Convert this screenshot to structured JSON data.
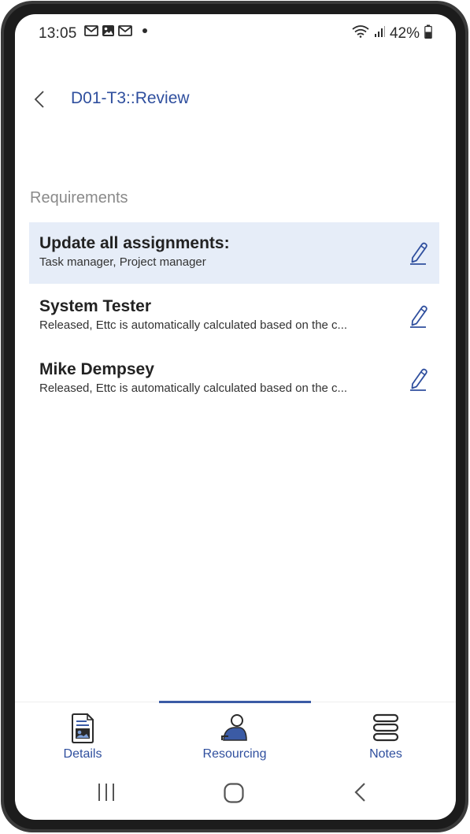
{
  "status_bar": {
    "time": "13:05",
    "battery": "42%",
    "notification_icons": [
      "gmail-icon",
      "image-icon",
      "gmail-icon",
      "dot-icon"
    ]
  },
  "header": {
    "title": "D01-T3::Review"
  },
  "section_title": "Requirements",
  "items": [
    {
      "title": "Update all assignments:",
      "subtitle": "Task manager, Project manager",
      "selected": true
    },
    {
      "title": "System Tester",
      "subtitle": "Released, Ettc is automatically calculated based on the c...",
      "selected": false
    },
    {
      "title": "Mike Dempsey",
      "subtitle": "Released, Ettc is automatically calculated based on the c...",
      "selected": false
    }
  ],
  "bottom_nav": {
    "tabs": [
      {
        "label": "Details",
        "icon": "details-icon"
      },
      {
        "label": "Resourcing",
        "icon": "resourcing-icon",
        "active": true
      },
      {
        "label": "Notes",
        "icon": "notes-icon"
      }
    ]
  },
  "colors": {
    "accent": "#2f4f9e",
    "selected_row": "#e6edf8",
    "indicator": "#3b5ba5"
  }
}
